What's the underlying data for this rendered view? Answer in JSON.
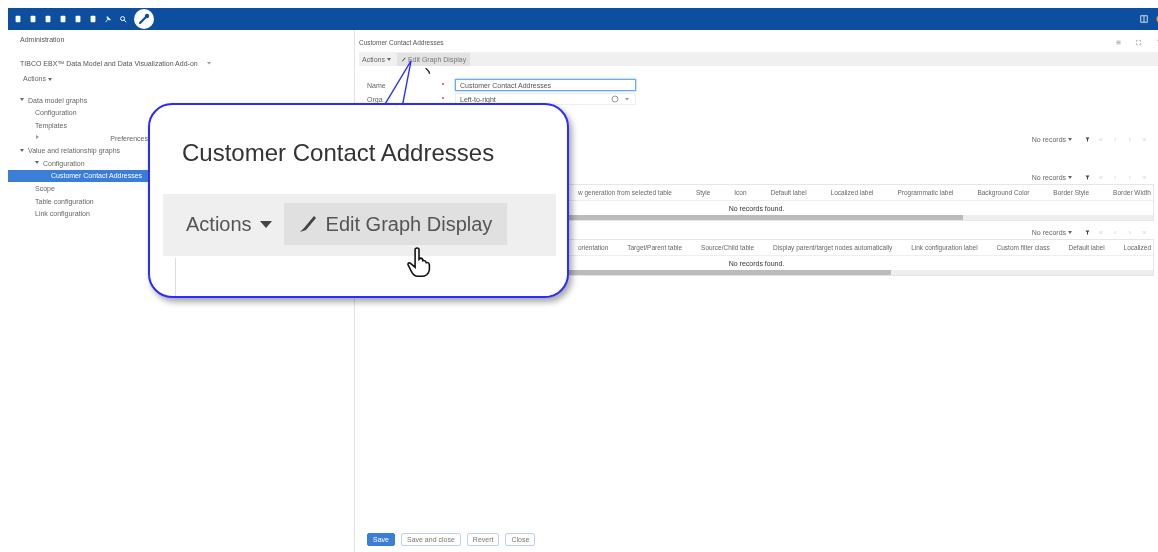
{
  "left_panel": {
    "title": "Administration",
    "module": "TIBCO EBX™ Data Model and Data Visualization Add-on",
    "actions": "Actions",
    "tree": [
      {
        "label": "Data model graphs",
        "expanded": true,
        "selected": false,
        "children": [
          {
            "label": "Configuration",
            "selected": false
          },
          {
            "label": "Templates",
            "selected": false
          },
          {
            "label": "Preferences",
            "expanded": false,
            "selected": false
          }
        ]
      },
      {
        "label": "Value and relationship graphs",
        "expanded": true,
        "selected": false,
        "children": [
          {
            "label": "Configuration",
            "expanded": true,
            "selected": false,
            "children": [
              {
                "label": "Customer Contact Addresses",
                "selected": true
              }
            ]
          },
          {
            "label": "Scope",
            "selected": false
          },
          {
            "label": "Table configuration",
            "selected": false
          },
          {
            "label": "Link configuration",
            "selected": false
          }
        ]
      }
    ]
  },
  "main": {
    "title": "Customer Contact Addresses",
    "toolbar": {
      "actions": "Actions",
      "edit": "Edit Graph Display"
    },
    "fields": [
      {
        "label": "Name",
        "required": true,
        "kind": "text",
        "value": "Customer Contact Addresses"
      },
      {
        "label": "Orga",
        "required": true,
        "kind": "select",
        "value": "Left-to-right"
      }
    ],
    "pager": "No records",
    "tables": [
      {
        "pager": "No records",
        "columns": [
          "w generation from selected table",
          "Style",
          "Icon",
          "Default label",
          "Localized label",
          "Programmatic label",
          "Background Color",
          "Border Style",
          "Border Width"
        ],
        "empty": "No records found."
      },
      {
        "pager": "No records",
        "columns": [
          "orientation",
          "Target/Parent table",
          "Source/Child table",
          "Display parent/target nodes automatically",
          "Link configuration label",
          "Custom filter class",
          "Default label",
          "Localized"
        ],
        "empty": "No records found."
      }
    ],
    "buttons": [
      {
        "label": "Save",
        "primary": true
      },
      {
        "label": "Save and close",
        "primary": false
      },
      {
        "label": "Revert",
        "primary": false
      },
      {
        "label": "Close",
        "primary": false
      }
    ]
  },
  "callout": {
    "title": "Customer Contact Addresses",
    "actions": "Actions",
    "edit": "Edit Graph Display"
  }
}
